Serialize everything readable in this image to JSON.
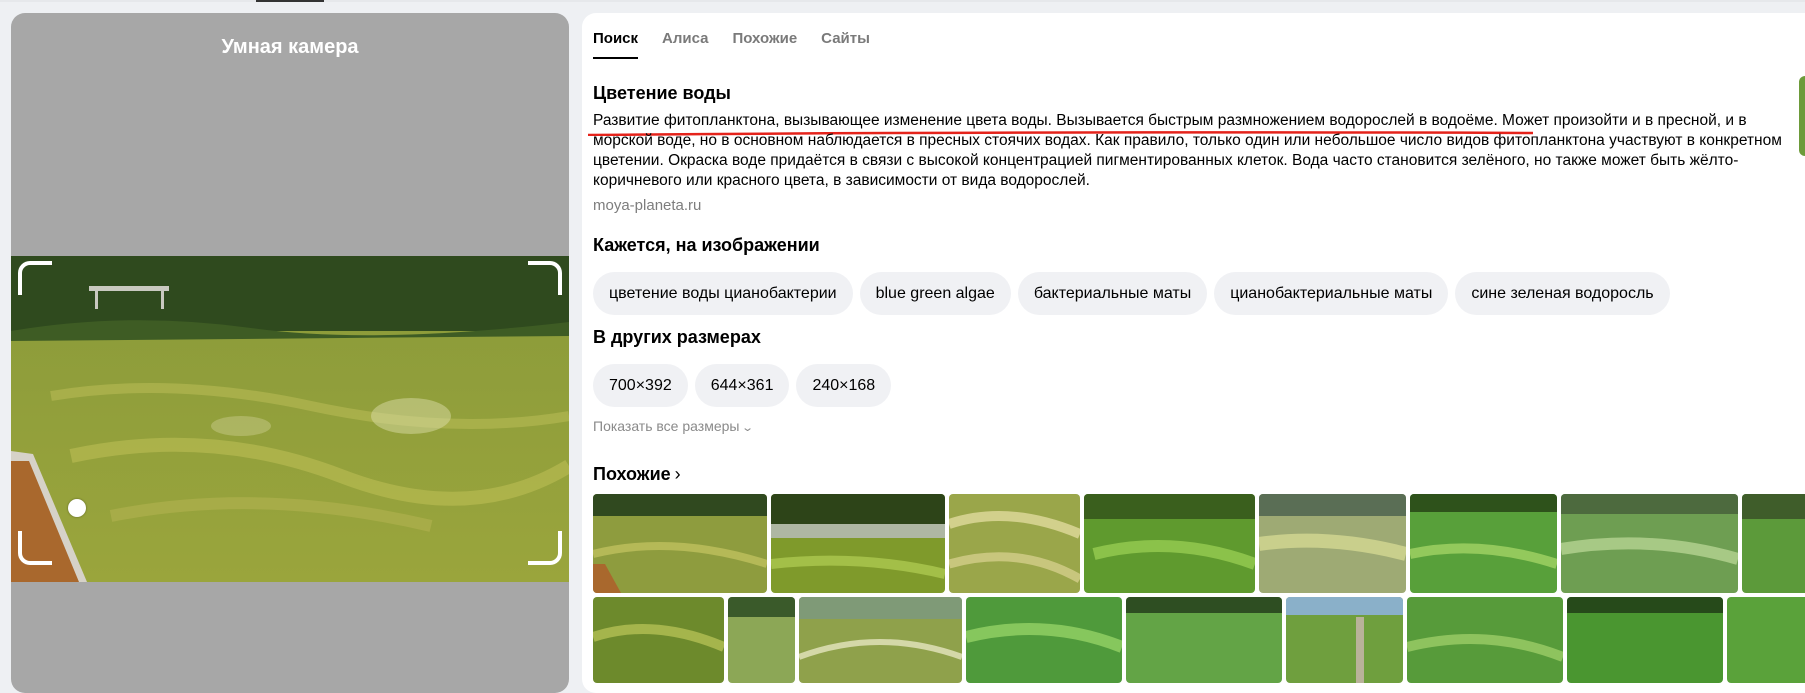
{
  "camera": {
    "title": "Умная камера"
  },
  "tabs": [
    {
      "label": "Поиск",
      "active": true
    },
    {
      "label": "Алиса",
      "active": false
    },
    {
      "label": "Похожие",
      "active": false
    },
    {
      "label": "Сайты",
      "active": false
    }
  ],
  "entity": {
    "title": "Цветение воды",
    "description": "Развитие фитопланктона, вызывающее изменение цвета воды. Вызывается быстрым размножением водорослей в водоёме. Может произойти и в пресной, и в морской воде, но в основном наблюдается в пресных стоячих водах. Как правило, только один или небольшое число видов фитопланктона участвуют в конкретном цветении. Окраска воде придаётся в связи с высокой концентрацией пигментированных клеток. Вода часто становится зелёного, но также может быть жёлто-коричневого или красного цвета, в зависимости от вида водорослей.",
    "source": "moya-planeta.ru"
  },
  "tags": {
    "title": "Кажется, на изображении",
    "items": [
      "цветение воды цианобактерии",
      "blue green algae",
      "бактериальные маты",
      "цианобактериальные маты",
      "сине зеленая водоросль"
    ]
  },
  "sizes": {
    "title": "В других размерах",
    "items": [
      "700×392",
      "644×361",
      "240×168"
    ],
    "show_all": "Показать все размеры"
  },
  "similar": {
    "title": "Похожие"
  },
  "colors": {
    "accent_red": "#e5231b",
    "chip_bg": "#f0f1f4",
    "panel_gray": "#a7a7a7"
  }
}
